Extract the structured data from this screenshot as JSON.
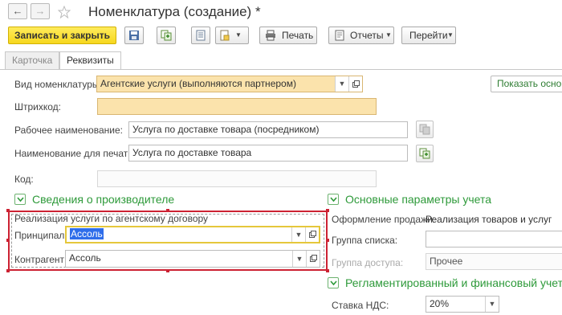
{
  "window": {
    "title": "Номенклатура (создание) *",
    "back": "←",
    "forward": "→"
  },
  "toolbar": {
    "save_close": "Записать и закрыть",
    "print": "Печать",
    "reports": "Отчеты",
    "goto": "Перейти"
  },
  "tabs": [
    {
      "label": "Карточка"
    },
    {
      "label": "Реквизиты"
    }
  ],
  "form": {
    "item_type_label": "Вид номенклатуры:",
    "item_type_value": "Агентские услуги (выполняются партнером)",
    "show_basic": "Показать основ",
    "barcode_label": "Штрихкод:",
    "barcode_value": "",
    "working_name_label": "Рабочее наименование:",
    "working_name_value": "Услуга по доставке товара (посредником)",
    "print_name_label": "Наименование для печати:",
    "print_name_value": "Услуга по доставке товара",
    "code_label": "Код:",
    "code_value": ""
  },
  "manufacturer": {
    "header": "Сведения о производителе",
    "agent_contract_text": "Реализация услуги по агентскому договору",
    "principal_label": "Принципал:",
    "principal_value": "Ассоль",
    "counterparty_label": "Контрагент:",
    "counterparty_value": "Ассоль"
  },
  "accounting": {
    "header": "Основные параметры учета",
    "sale_registration_label": "Оформление продажи:",
    "sale_registration_value": "Реализация товаров и услуг",
    "list_group_label": "Группа списка:",
    "list_group_value": "",
    "access_group_label": "Группа доступа:",
    "access_group_value": "Прочее"
  },
  "regulated": {
    "header": "Регламентированный и финансовый учет",
    "vat_label": "Ставка НДС:",
    "vat_value": "20%"
  },
  "colors": {
    "accent_yellow": "#f6d71e",
    "section_green": "#2e9a3a",
    "highlight_red": "#cc2233",
    "required_yellow": "#fbe3ac"
  }
}
